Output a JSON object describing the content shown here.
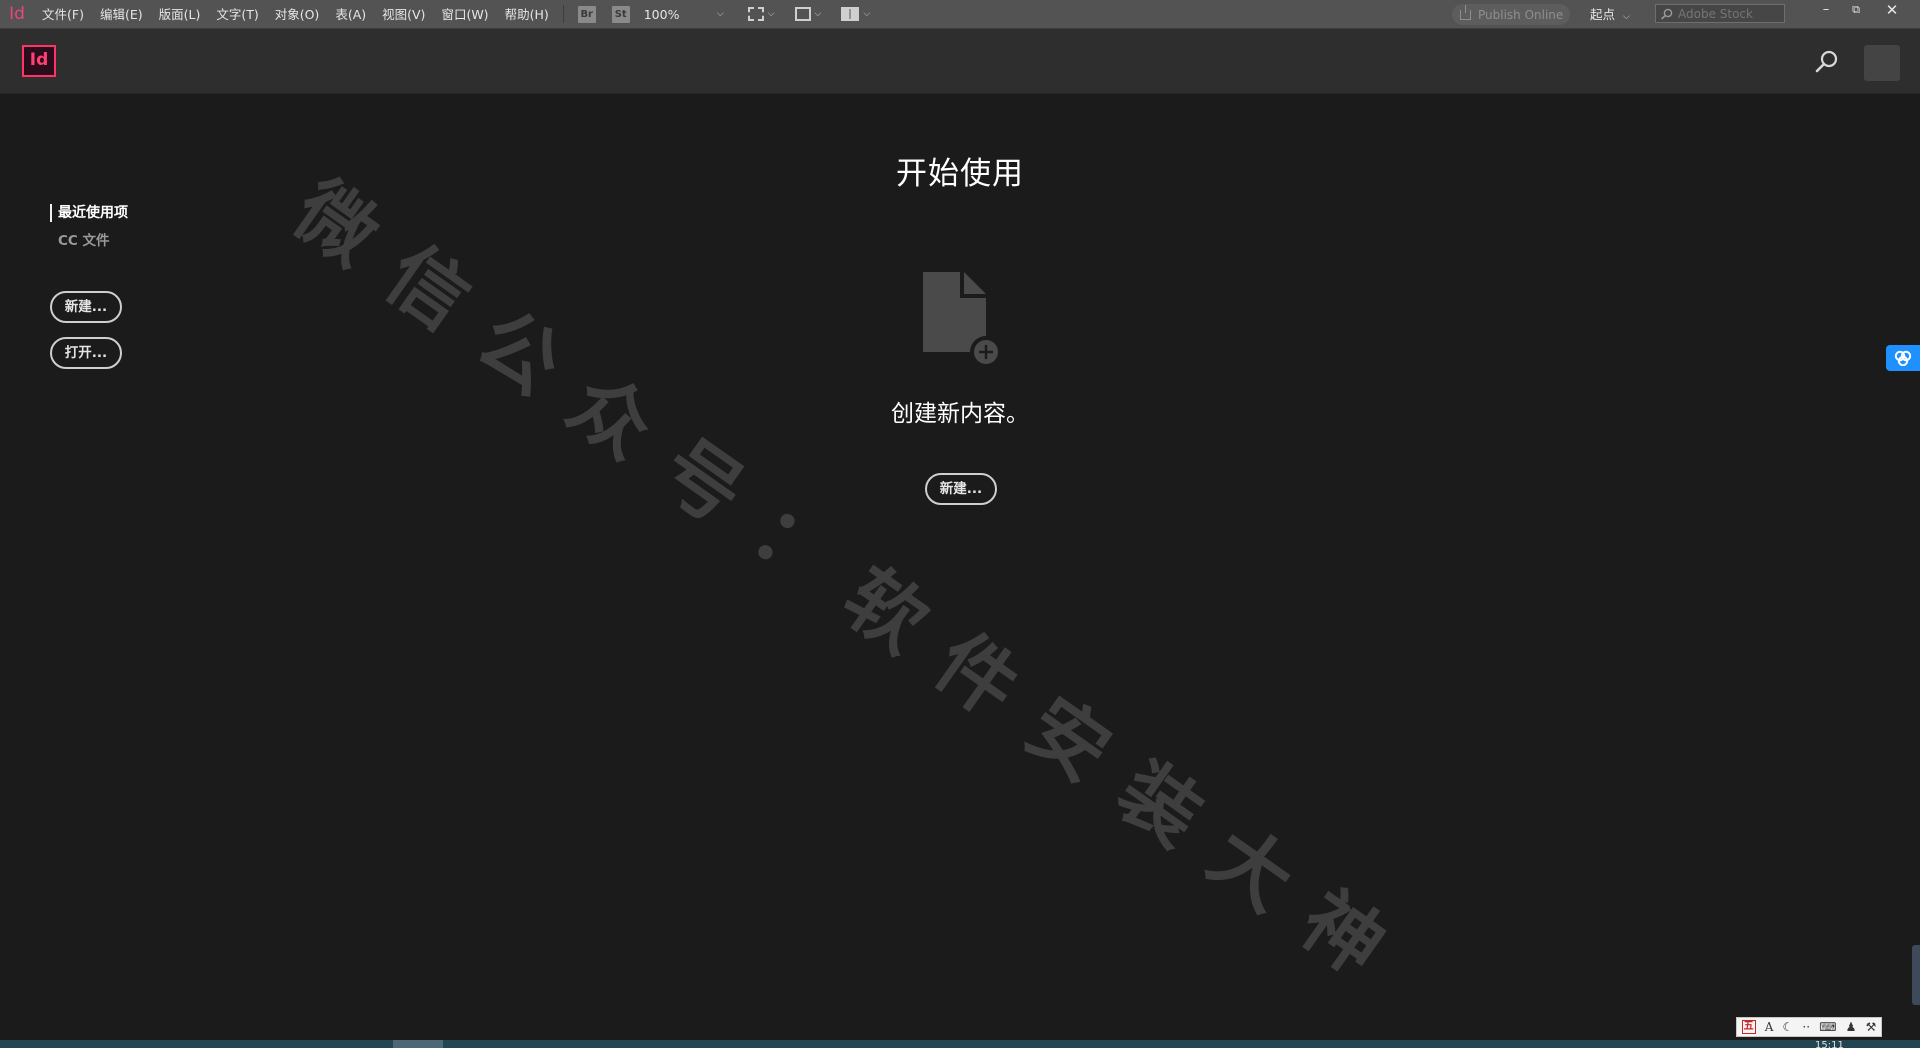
{
  "menubar": {
    "app_mini_logo": "Id",
    "items": [
      "文件(F)",
      "编辑(E)",
      "版面(L)",
      "文字(T)",
      "对象(O)",
      "表(A)",
      "视图(V)",
      "窗口(W)",
      "帮助(H)"
    ],
    "bridge_badge": "Br",
    "stock_badge": "St",
    "zoom": "100%",
    "publish_online": "Publish Online",
    "workspace": "起点",
    "stock_search_placeholder": "Adobe Stock"
  },
  "header": {
    "logo_text": "Id"
  },
  "sidebar": {
    "nav_recent": "最近使用项",
    "nav_cc": "CC 文件",
    "new_button": "新建...",
    "open_button": "打开..."
  },
  "main": {
    "title": "开始使用",
    "create_text": "创建新内容。",
    "new_button": "新建..."
  },
  "watermark": "微信公众号：软件安装大神",
  "clock": "15:11",
  "colors": {
    "brand_accent": "#ff3366",
    "background": "#1b1b1b",
    "header": "#2e2e2e",
    "menubar": "#535353",
    "cloud_widget": "#1e90ff"
  },
  "icons": [
    "search-icon",
    "avatar",
    "new-document-icon",
    "plus-icon",
    "cloud-icon"
  ]
}
